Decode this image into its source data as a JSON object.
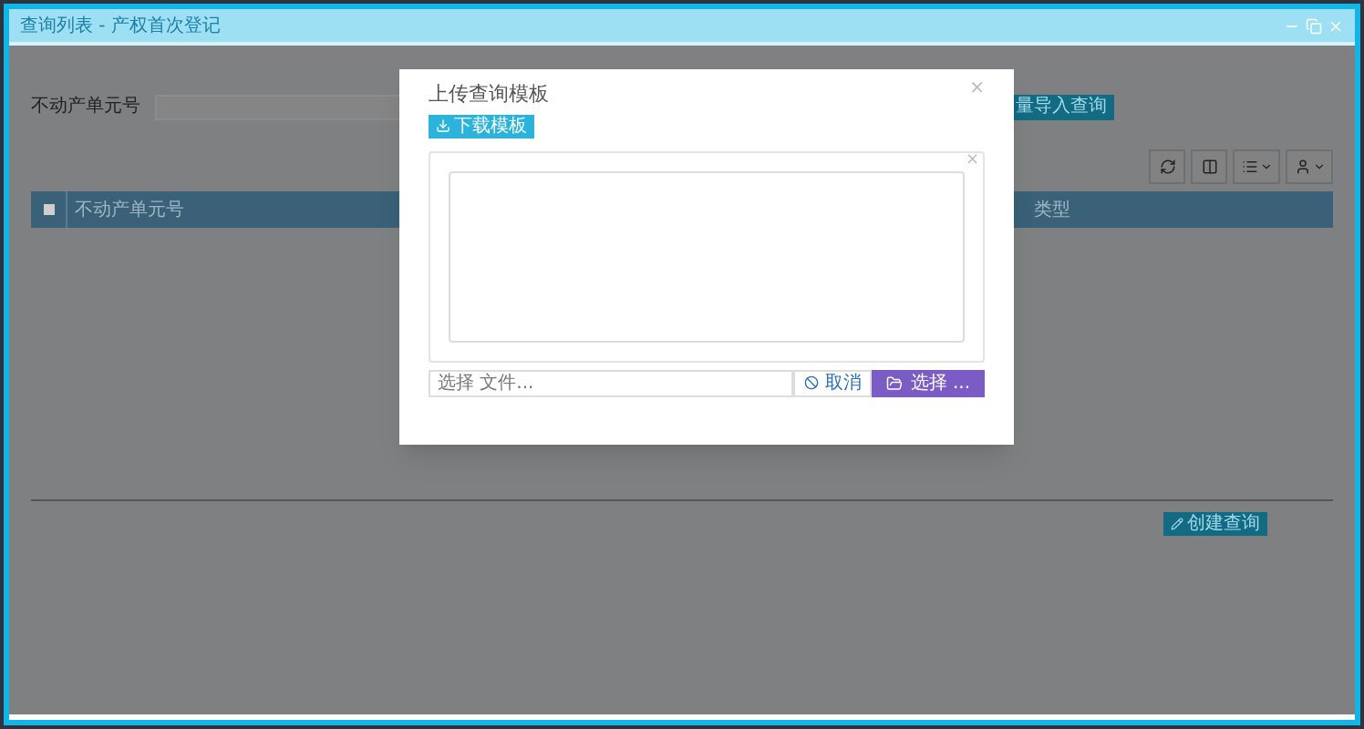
{
  "window": {
    "title": "查询列表 - 产权首次登记"
  },
  "page": {
    "search_label": "不动产单元号",
    "import_button": "量导入查询"
  },
  "table": {
    "columns": [
      "不动产单元号",
      "类型"
    ],
    "select_all": {
      "checked": false
    }
  },
  "create_button": "创建查询",
  "dialog": {
    "title": "上传查询模板",
    "close": "×",
    "download_button": "下载模板",
    "preview_close": "×",
    "file_field": {
      "placeholder": "选择 文件..."
    },
    "cancel_button": "取消",
    "browse_button": "选择 ..."
  }
}
